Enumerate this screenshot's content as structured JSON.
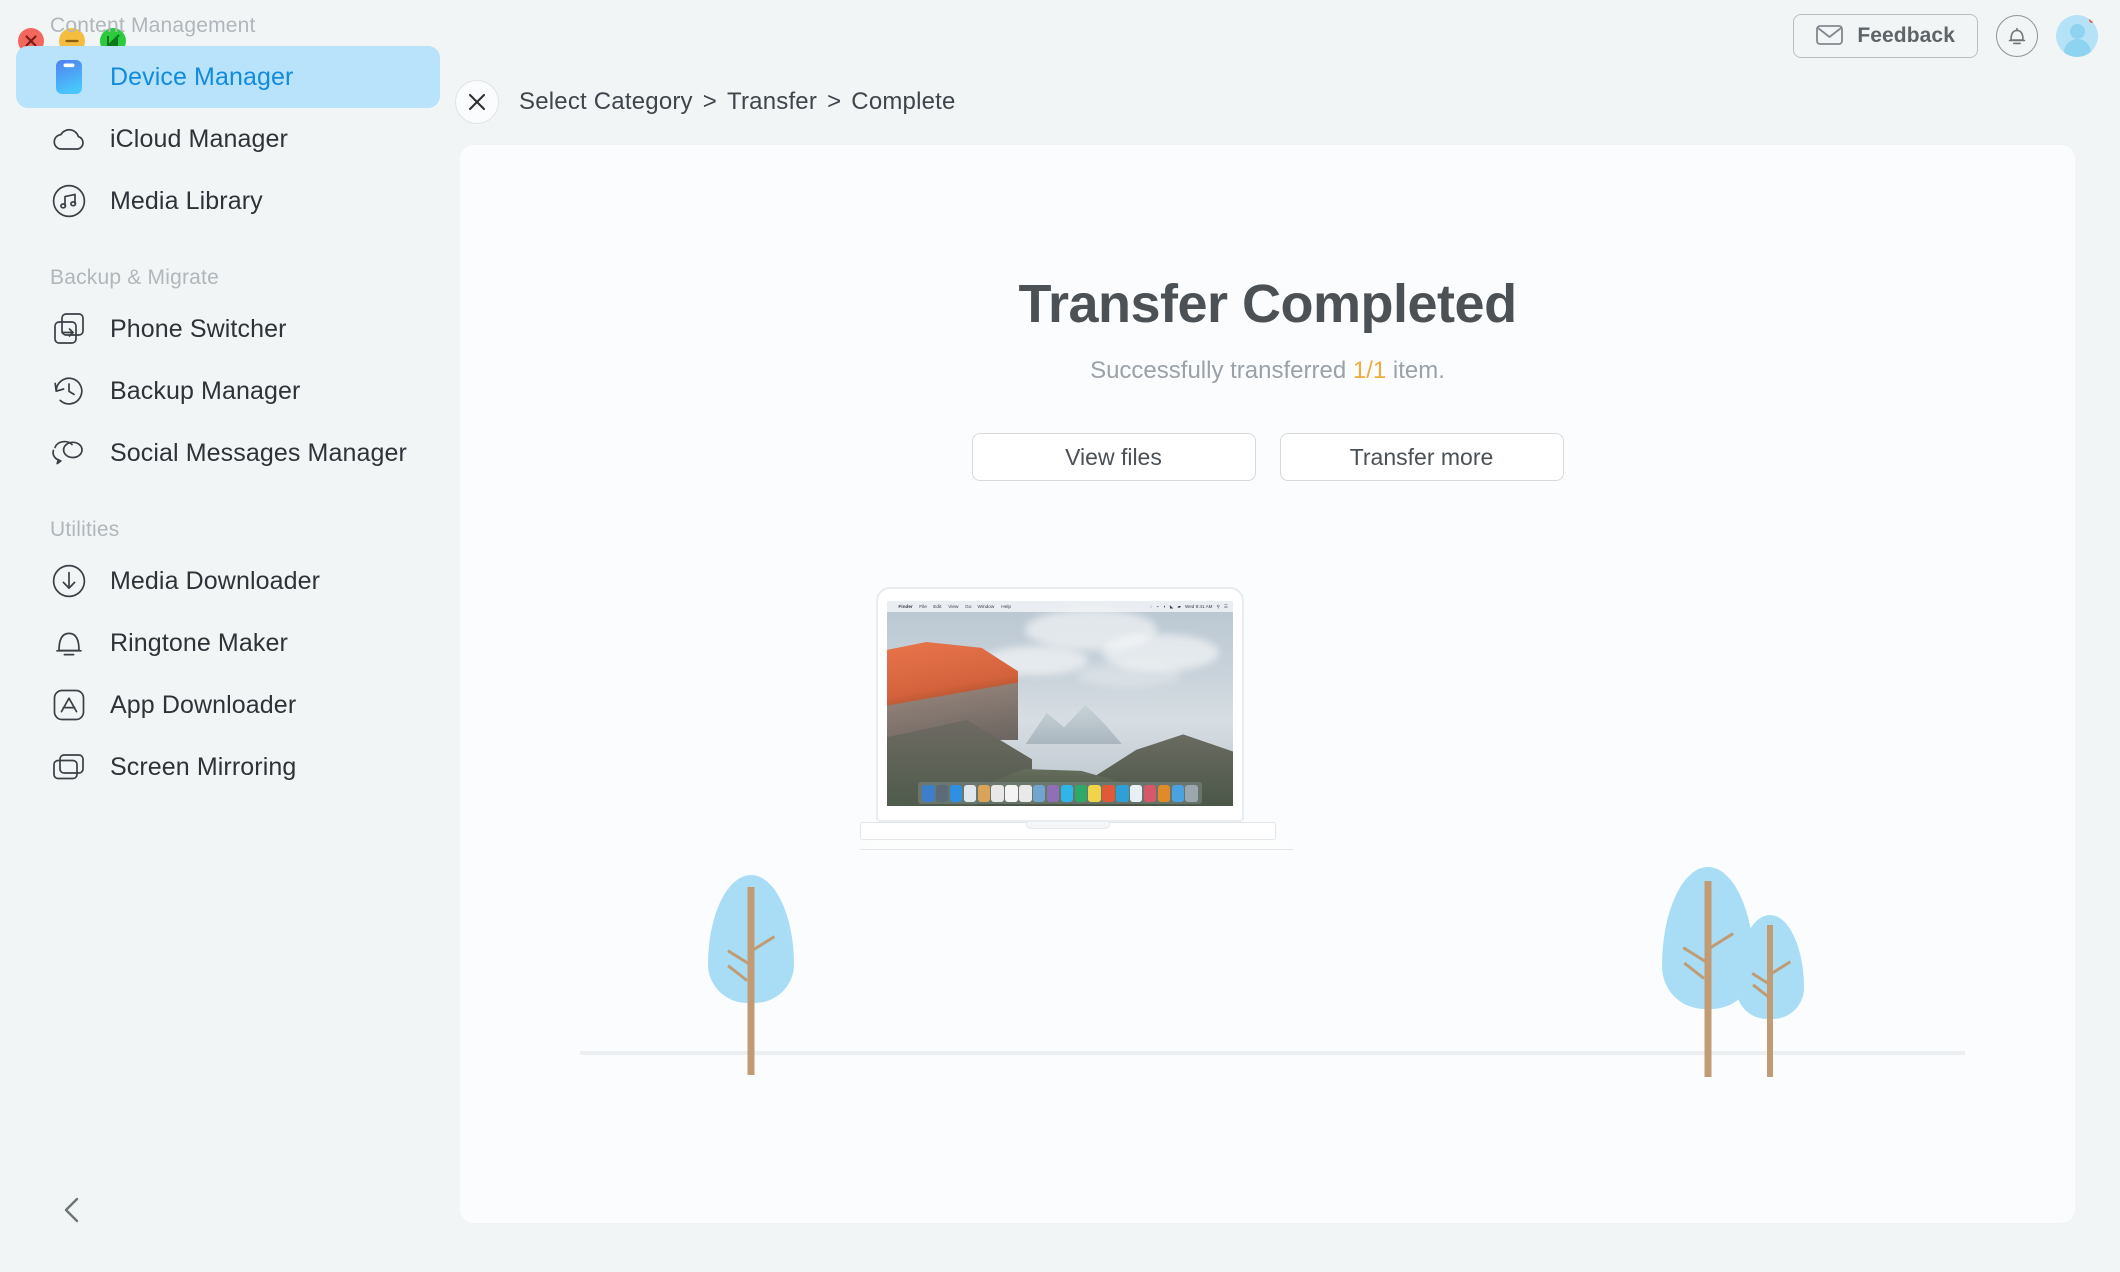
{
  "window": {
    "controls": [
      {
        "name": "close",
        "glyph": "✕",
        "color": "#f2685f"
      },
      {
        "name": "minimize",
        "glyph": "−",
        "color": "#f4bd3f"
      },
      {
        "name": "maximize",
        "glyph": "⤢",
        "color": "#2dc93f"
      }
    ]
  },
  "header": {
    "feedback_label": "Feedback",
    "feedback_icon": "envelope-icon",
    "bell_icon": "notification-bell-icon",
    "avatar_icon": "user-avatar"
  },
  "sidebar": {
    "groups": [
      {
        "title": "Content Management",
        "items": [
          {
            "label": "Device Manager",
            "icon": "device-phone-icon",
            "active": true
          },
          {
            "label": "iCloud Manager",
            "icon": "cloud-icon",
            "active": false
          },
          {
            "label": "Media Library",
            "icon": "music-note-circle-icon",
            "active": false
          }
        ]
      },
      {
        "title": "Backup & Migrate",
        "items": [
          {
            "label": "Phone Switcher",
            "icon": "phone-transfer-icon",
            "active": false
          },
          {
            "label": "Backup Manager",
            "icon": "clock-restore-icon",
            "active": false
          },
          {
            "label": "Social Messages Manager",
            "icon": "chat-bubbles-icon",
            "active": false
          }
        ]
      },
      {
        "title": "Utilities",
        "items": [
          {
            "label": "Media Downloader",
            "icon": "download-arrow-circle-icon",
            "active": false
          },
          {
            "label": "Ringtone Maker",
            "icon": "bell-icon",
            "active": false
          },
          {
            "label": "App Downloader",
            "icon": "app-store-icon",
            "active": false
          },
          {
            "label": "Screen Mirroring",
            "icon": "screens-stack-icon",
            "active": false
          }
        ]
      }
    ],
    "collapse_icon": "chevron-left-icon"
  },
  "breadcrumb": {
    "close_icon": "close-x-icon",
    "steps": [
      "Select Category",
      "Transfer",
      "Complete"
    ],
    "separator": ">"
  },
  "main": {
    "title": "Transfer Completed",
    "subtitle_prefix": "Successfully transferred ",
    "subtitle_count": "1/1",
    "subtitle_suffix": " item.",
    "highlight_color": "#f0ab3d",
    "buttons": [
      {
        "label": "View files",
        "name": "view-files-button"
      },
      {
        "label": "Transfer more",
        "name": "transfer-more-button"
      }
    ]
  },
  "illustration": {
    "name": "macbook-with-trees-illustration",
    "laptop": {
      "menubar": {
        "apple": "",
        "items": [
          "Finder",
          "File",
          "Edit",
          "View",
          "Go",
          "Window",
          "Help"
        ],
        "clock": "Wed 9:41 AM"
      },
      "wallpaper": "el-capitan-yosemite",
      "dock_icon_count": 20
    },
    "trees": [
      {
        "name": "tree-left",
        "size": "medium"
      },
      {
        "name": "tree-right-large",
        "size": "large"
      },
      {
        "name": "tree-right-small",
        "size": "small"
      }
    ],
    "leaf_color": "#a8ddf5",
    "trunk_color": "#c09b74"
  }
}
